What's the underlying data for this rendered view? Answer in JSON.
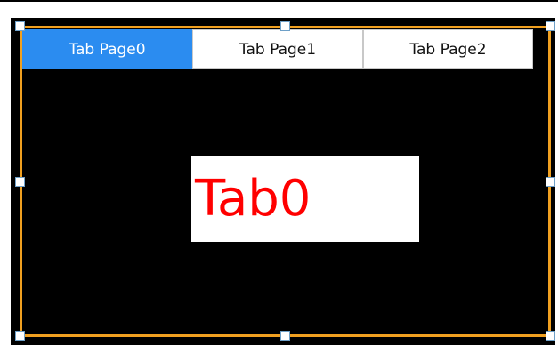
{
  "tabs": [
    {
      "label": "Tab Page0",
      "active": true
    },
    {
      "label": "Tab Page1",
      "active": false
    },
    {
      "label": "Tab Page2",
      "active": false
    }
  ],
  "content": {
    "label": "Tab0"
  },
  "colors": {
    "active_tab": "#2b8cf0",
    "selection_border": "#f0a020",
    "content_text": "#ff0000",
    "panel_background": "#000000"
  }
}
